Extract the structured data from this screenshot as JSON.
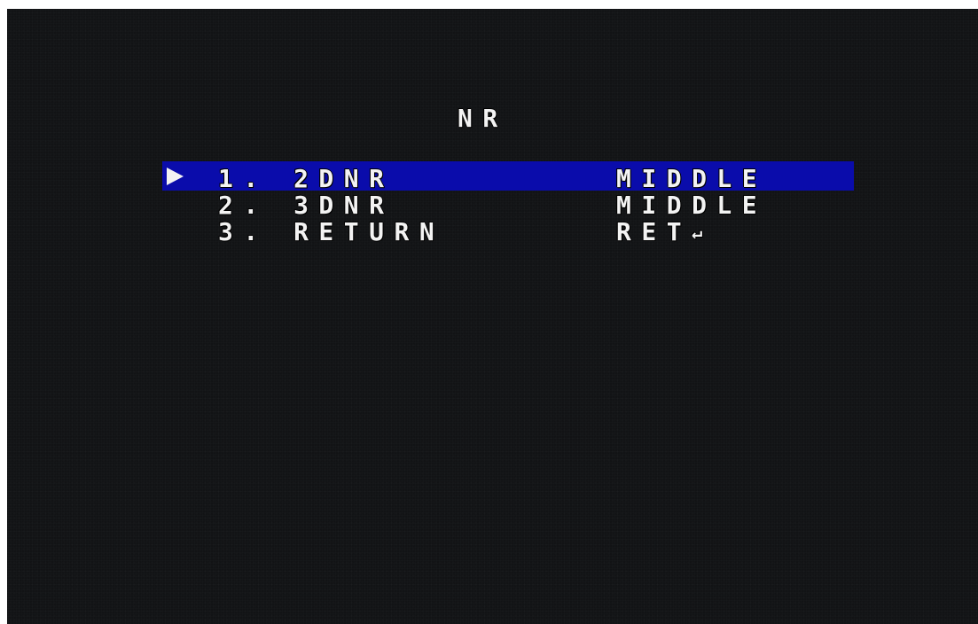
{
  "menu": {
    "title": "NR",
    "selected_index": 0,
    "pointer_icon": "triangle-right-icon",
    "items": [
      {
        "label": "1. 2DNR",
        "value": "MIDDLE"
      },
      {
        "label": "2. 3DNR",
        "value": "MIDDLE"
      },
      {
        "label": "3. RETURN",
        "value": "RET",
        "value_icon": "return-arrow-icon",
        "value_symbol": "↵"
      }
    ]
  },
  "colors": {
    "background": "#121315",
    "highlight": "#0a0cab",
    "text": "#f3f3f3"
  }
}
